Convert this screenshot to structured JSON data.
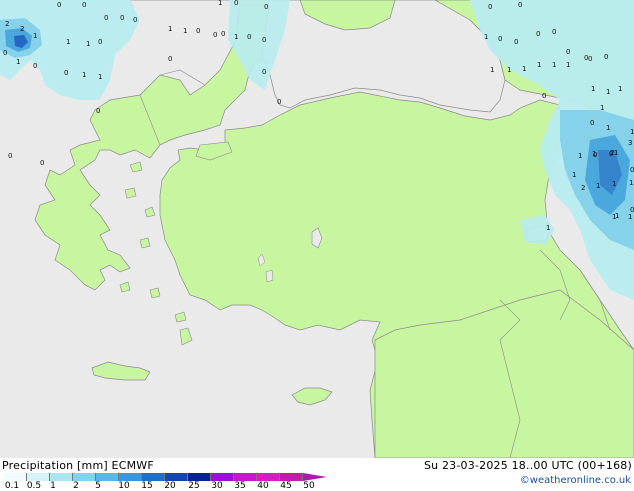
{
  "title": "Precipitation [mm] ECMWF",
  "valid_time": "Su 23-03-2025 18..00 UTC (00+168)",
  "credit": "©weatheronline.co.uk",
  "colors": {
    "land": "#c8f5a0",
    "sea": "#eaeaea",
    "coast": "#8a8a8a",
    "precip_light": "#b8ecf0",
    "precip_mid": "#86d2ea",
    "precip_heavy": "#4aa8dc",
    "precip_max": "#2466c0"
  },
  "legend": {
    "ticks": [
      "0.1",
      "0.5",
      "1",
      "2",
      "5",
      "10",
      "15",
      "20",
      "25",
      "30",
      "35",
      "40",
      "45",
      "50"
    ],
    "swatches": [
      "#f0fcfc",
      "#d6f4f8",
      "#aae6f0",
      "#82d4ec",
      "#5ab8e6",
      "#3a96da",
      "#2070c8",
      "#1448b0",
      "#0a2490",
      "#9a12d4",
      "#c41ac8",
      "#d41ebe",
      "#c020a4"
    ]
  },
  "grid_values": [
    {
      "t": "2"
    },
    {
      "t": "2"
    },
    {
      "t": "1"
    },
    {
      "t": "0"
    },
    {
      "t": "0"
    },
    {
      "t": "0"
    },
    {
      "t": "0"
    },
    {
      "t": "0"
    },
    {
      "t": "0"
    },
    {
      "t": "1"
    },
    {
      "t": "1"
    },
    {
      "t": "0"
    },
    {
      "t": "1"
    },
    {
      "t": "0"
    },
    {
      "t": "0"
    },
    {
      "t": "1"
    },
    {
      "t": "1"
    },
    {
      "t": "0"
    },
    {
      "t": "1"
    },
    {
      "t": "1"
    },
    {
      "t": "0"
    },
    {
      "t": "0"
    },
    {
      "t": "1"
    },
    {
      "t": "0"
    },
    {
      "t": "0"
    },
    {
      "t": "1"
    },
    {
      "t": "0"
    },
    {
      "t": "0"
    },
    {
      "t": "0"
    },
    {
      "t": "0"
    },
    {
      "t": "0"
    },
    {
      "t": "0"
    },
    {
      "t": "0"
    },
    {
      "t": "0"
    },
    {
      "t": "0"
    },
    {
      "t": "0"
    },
    {
      "t": "1"
    },
    {
      "t": "0"
    },
    {
      "t": "0"
    },
    {
      "t": "0"
    },
    {
      "t": "0"
    },
    {
      "t": "0"
    },
    {
      "t": "0"
    },
    {
      "t": "0"
    },
    {
      "t": "1"
    },
    {
      "t": "1"
    },
    {
      "t": "1"
    },
    {
      "t": "1"
    },
    {
      "t": "1"
    },
    {
      "t": "1"
    },
    {
      "t": "0"
    },
    {
      "t": "0"
    },
    {
      "t": "1"
    },
    {
      "t": "1"
    },
    {
      "t": "0"
    },
    {
      "t": "1"
    },
    {
      "t": "1"
    },
    {
      "t": "1"
    },
    {
      "t": "0"
    },
    {
      "t": "1"
    },
    {
      "t": "0"
    },
    {
      "t": "1"
    },
    {
      "t": "2"
    },
    {
      "t": "1"
    },
    {
      "t": "1"
    },
    {
      "t": "1"
    },
    {
      "t": "1"
    },
    {
      "t": "1"
    },
    {
      "t": "2"
    },
    {
      "t": "1"
    },
    {
      "t": "3"
    },
    {
      "t": "1"
    },
    {
      "t": "1"
    },
    {
      "t": "0"
    },
    {
      "t": "1"
    },
    {
      "t": "0"
    },
    {
      "t": "1"
    }
  ]
}
